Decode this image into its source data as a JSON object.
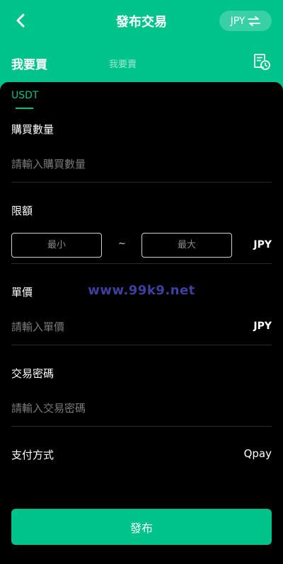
{
  "header": {
    "title": "發布交易",
    "currency": "JPY",
    "back_icon": "chevron-left-icon",
    "swap_icon": "swap-icon",
    "history_icon": "history-doc-icon"
  },
  "tabs": {
    "buy": "我要買",
    "sell": "我要賣"
  },
  "coin_tab": "USDT",
  "form": {
    "quantity": {
      "label": "購買數量",
      "placeholder": "請輸入購買數量"
    },
    "limit": {
      "label": "限額",
      "min_placeholder": "最小",
      "separator": "~",
      "max_placeholder": "最大",
      "unit": "JPY"
    },
    "price": {
      "label": "單價",
      "placeholder": "請輸入單價",
      "unit": "JPY"
    },
    "password": {
      "label": "交易密碼",
      "placeholder": "請輸入交易密碼"
    },
    "payment": {
      "label": "支付方式",
      "value": "Qpay"
    }
  },
  "watermark": "www.99k9.net",
  "submit_label": "發布",
  "colors": {
    "accent": "#00c38b",
    "background": "#000000",
    "watermark": "#3f3f9f"
  }
}
